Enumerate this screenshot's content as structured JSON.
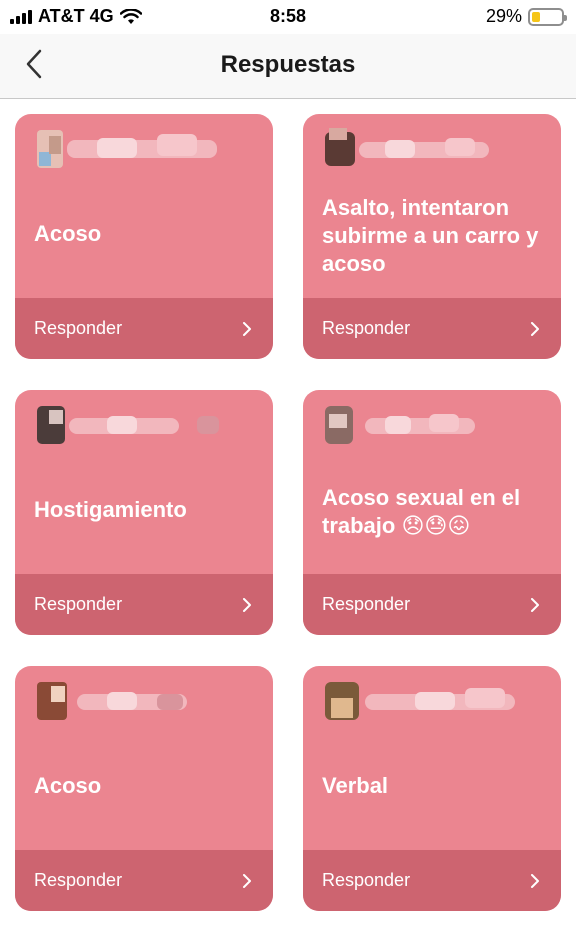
{
  "status_bar": {
    "carrier": "AT&T 4G",
    "time": "8:58",
    "battery_percent": "29%",
    "battery_level": 0.29,
    "battery_color": "#f5c518"
  },
  "nav": {
    "title": "Respuestas",
    "back_icon": "chevron-left-icon"
  },
  "colors": {
    "card_bg": "#eb8590",
    "card_footer": "#cd6470"
  },
  "cards": [
    {
      "title": "Acoso",
      "reply_label": "Responder"
    },
    {
      "title": "Asalto, intentaron subirme a un carro y acoso",
      "reply_label": "Responder"
    },
    {
      "title": "Hostigamiento",
      "reply_label": "Responder"
    },
    {
      "title": "Acoso sexual en el trabajo 😞😓😖",
      "reply_label": "Responder"
    },
    {
      "title": "Acoso",
      "reply_label": "Responder"
    },
    {
      "title": "Verbal",
      "reply_label": "Responder"
    }
  ]
}
